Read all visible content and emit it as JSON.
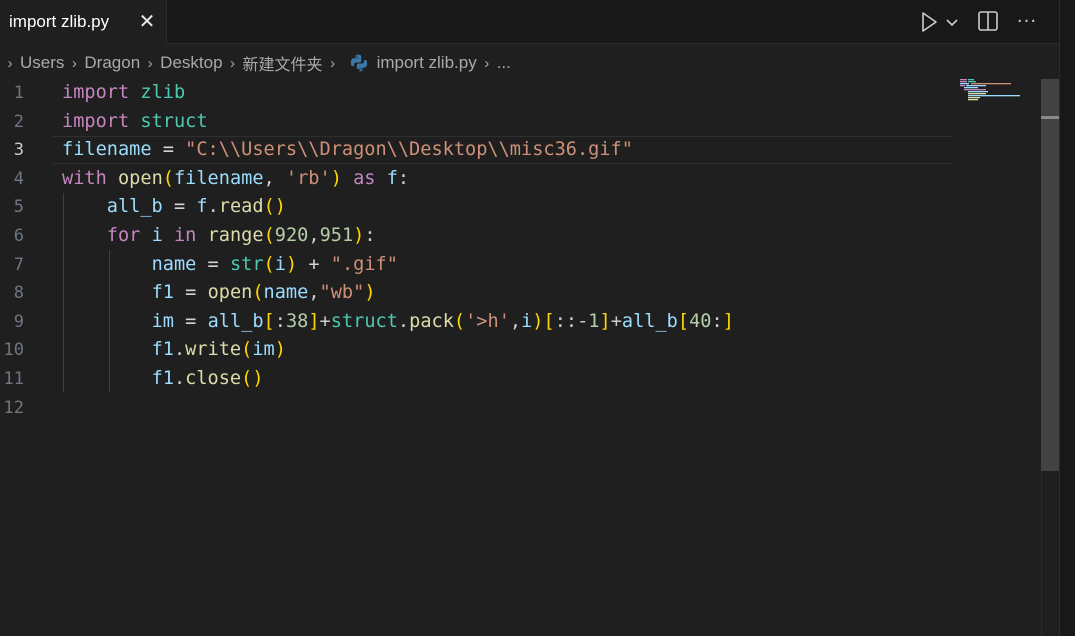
{
  "tab": {
    "label": "import zlib.py",
    "close_glyph": "✕"
  },
  "actions": {
    "run_icon": "play-icon",
    "run_menu_icon": "chevron-down-icon",
    "split_icon": "split-editor-icon",
    "more_icon": "ellipsis-icon",
    "more_glyph": "···"
  },
  "breadcrumb": {
    "items": [
      "Users",
      "Dragon",
      "Desktop",
      "新建文件夹"
    ],
    "file": "import zlib.py",
    "trailing": "..."
  },
  "editor": {
    "active_line": 3,
    "line_numbers": [
      "1",
      "2",
      "3",
      "4",
      "5",
      "6",
      "7",
      "8",
      "9",
      "10",
      "11",
      "12"
    ],
    "lines": [
      "import zlib",
      "import struct",
      "filename = \"C:\\\\Users\\\\Dragon\\\\Desktop\\\\misc36.gif\"",
      "with open(filename, 'rb') as f:",
      "    all_b = f.read()",
      "    for i in range(920,951):",
      "        name = str(i) + \".gif\"",
      "        f1 = open(name,\"wb\")",
      "        im = all_b[:38]+struct.pack('>h',i)[::-1]+all_b[40:]",
      "        f1.write(im)",
      "        f1.close()",
      ""
    ]
  },
  "colors": {
    "background": "#1f1f1f",
    "keyword": "#c586c0",
    "module": "#4ec9b0",
    "variable": "#9cdcfe",
    "string": "#ce9178",
    "function": "#dcdcaa",
    "builtin_keyword": "#569cd6",
    "number": "#b5cea8"
  }
}
